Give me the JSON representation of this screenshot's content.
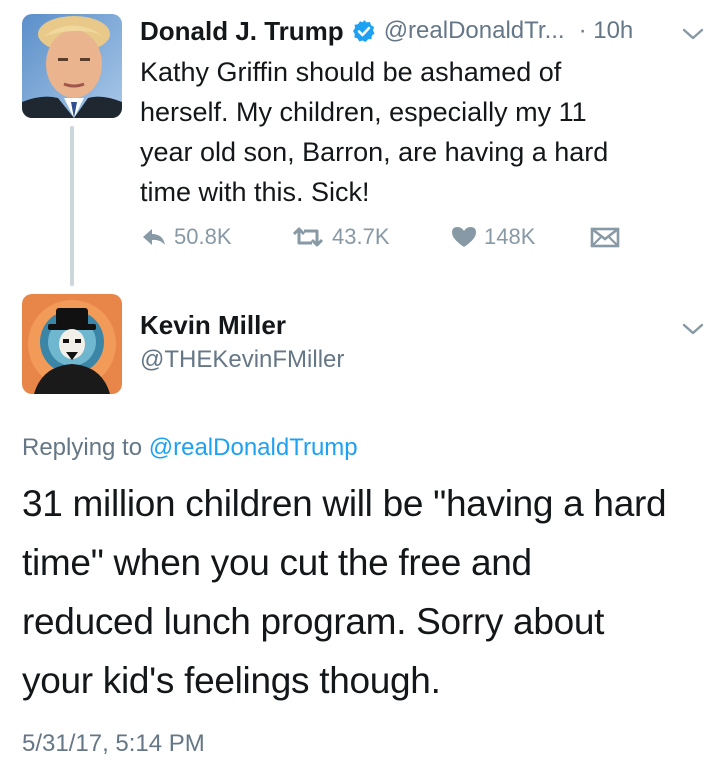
{
  "original_tweet": {
    "author_name": "Donald J. Trump",
    "verified_icon": "verified-badge-icon",
    "handle": "@realDonaldTr...",
    "time": "· 10h",
    "text_lines": [
      "Kathy Griffin should be ashamed of",
      "herself. My children, especially my 11",
      "year old son, Barron, are having a hard",
      "time with this. Sick!"
    ],
    "actions": {
      "reply_count": "50.8K",
      "retweet_count": "43.7K",
      "like_count": "148K",
      "icons": [
        "reply-icon",
        "retweet-icon",
        "heart-icon",
        "envelope-icon"
      ]
    }
  },
  "reply_tweet": {
    "author_name": "Kevin Miller",
    "handle": "@THEKevinFMiller",
    "replying_to_prefix": "Replying to ",
    "replying_to_handle": "@realDonaldTrump",
    "text_lines": [
      "31 million children will be \"having a hard",
      "time\" when you cut the free and",
      "reduced lunch program. Sorry about",
      "your kid's feelings though."
    ],
    "timestamp": "5/31/17, 5:14 PM"
  },
  "colors": {
    "text": "#14171a",
    "secondary": "#657786",
    "action_gray": "#8899a6",
    "link_blue": "#1da1f2",
    "thread_line": "#ccd6dd"
  }
}
